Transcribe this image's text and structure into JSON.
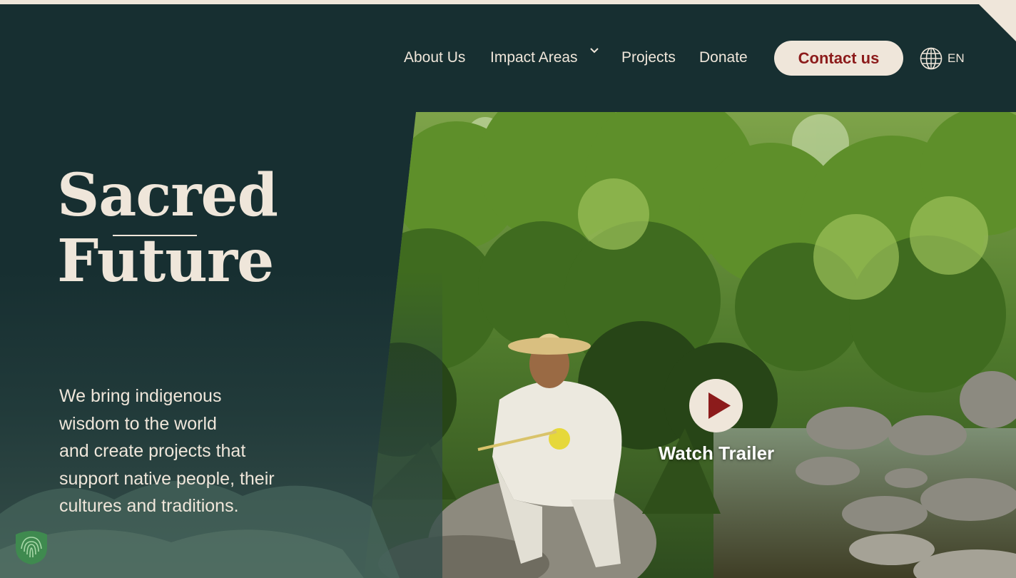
{
  "nav": {
    "about": "About Us",
    "impact": "Impact Areas",
    "projects": "Projects",
    "donate": "Donate",
    "contact": "Contact us",
    "language": "EN"
  },
  "hero": {
    "title_line1": "Sacred",
    "title_line2": "Future",
    "tagline": "We bring indigenous\nwisdom to the world\nand create projects that\nsupport native people, their\ncultures and traditions.",
    "watch_label": "Watch Trailer"
  },
  "icons": {
    "impact_dropdown": "chevron-down-icon",
    "language": "globe-icon",
    "play": "play-icon",
    "badge": "shield-fingerprint-icon"
  },
  "colors": {
    "background": "#172f31",
    "cream": "#efe6da",
    "accent": "#8c1b1b",
    "badge_green": "#3f8a4f"
  }
}
